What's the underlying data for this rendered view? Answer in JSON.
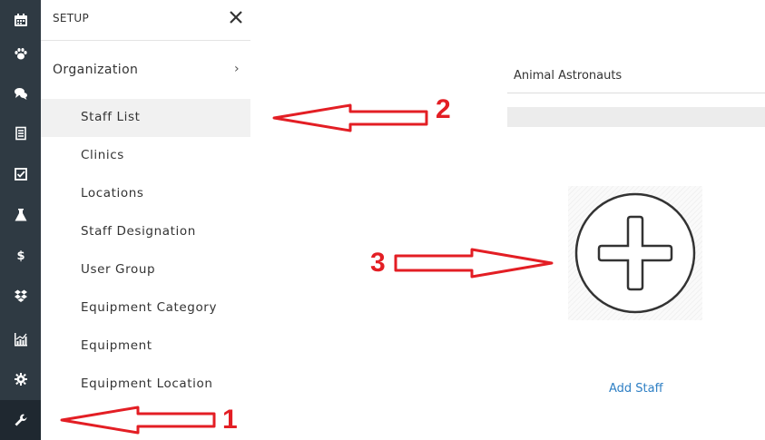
{
  "sidebar_icons": [
    {
      "name": "calendar-icon"
    },
    {
      "name": "paw-icon"
    },
    {
      "name": "chat-icon"
    },
    {
      "name": "document-icon"
    },
    {
      "name": "checkbox-icon"
    },
    {
      "name": "flask-icon"
    },
    {
      "name": "dollar-icon"
    },
    {
      "name": "dropbox-icon"
    },
    {
      "name": "chart-icon"
    },
    {
      "name": "gear-icon"
    },
    {
      "name": "wrench-icon",
      "active": true
    }
  ],
  "panel": {
    "title": "SETUP",
    "close_icon": "close-icon",
    "organization_label": "Organization",
    "organization_chevron": "›",
    "items": [
      {
        "label": "Staff List",
        "selected": true
      },
      {
        "label": "Clinics"
      },
      {
        "label": "Locations"
      },
      {
        "label": "Staff Designation"
      },
      {
        "label": "User Group"
      },
      {
        "label": "Equipment Category"
      },
      {
        "label": "Equipment"
      },
      {
        "label": "Equipment Location"
      }
    ]
  },
  "main": {
    "organization_name": "Animal Astronauts",
    "add_icon": "plus-circle-icon",
    "add_staff_label": "Add Staff"
  },
  "annotations": {
    "color": "#e31e24",
    "labels": [
      "1",
      "2",
      "3"
    ]
  },
  "colors": {
    "rail_bg": "#2f3a43",
    "link": "#2e7fc4",
    "selected_bg": "#f1f1f1"
  }
}
